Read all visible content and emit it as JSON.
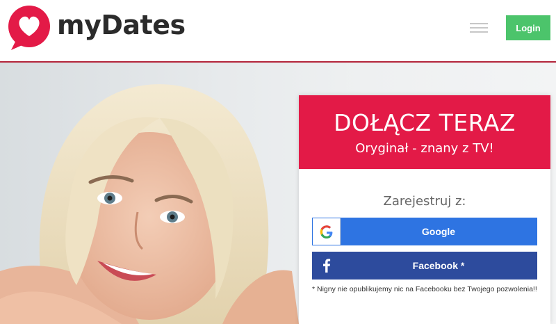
{
  "header": {
    "brand": "myDates",
    "login_label": "Login"
  },
  "hero": {
    "image": "smiling-blonde-woman-photo"
  },
  "signup_card": {
    "title": "DOŁĄCZ TERAZ",
    "subtitle": "Oryginał - znany z TV!",
    "register_with": "Zarejestruj z:",
    "google_label": "Google",
    "facebook_label": "Facebook *",
    "disclaimer": "* Nigny nie opublikujemy nic na Facebooku bez Twojego pozwolenia!!"
  },
  "colors": {
    "brand_red": "#e31a47",
    "header_rule": "#b3243a",
    "login_green": "#4cc46b",
    "google_blue": "#2e74e2",
    "facebook_blue": "#2d4b9d"
  }
}
